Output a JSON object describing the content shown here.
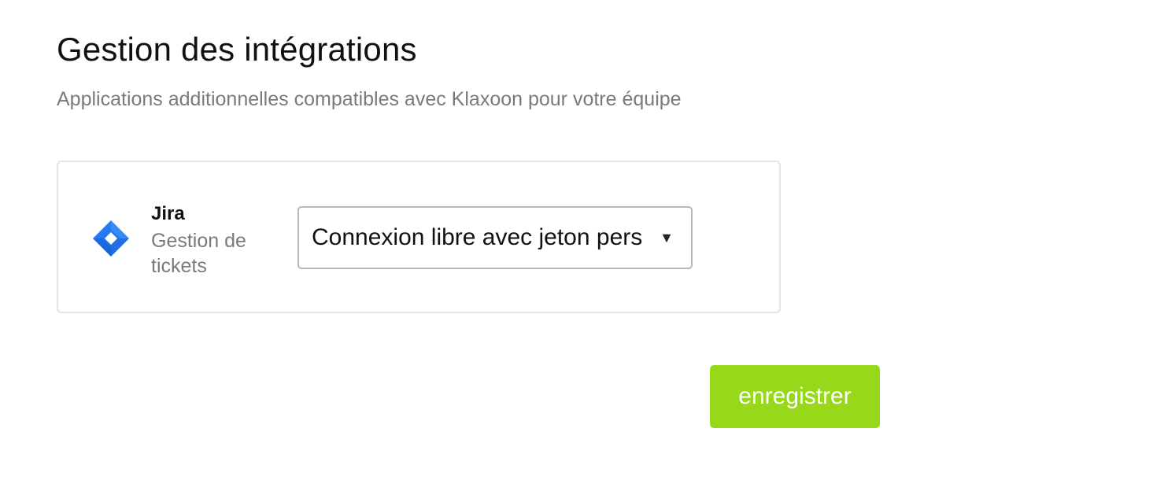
{
  "header": {
    "title": "Gestion des intégrations",
    "subtitle": "Applications additionnelles compatibles avec Klaxoon pour votre équipe"
  },
  "integrations": [
    {
      "name": "Jira",
      "description": "Gestion de tickets",
      "icon": "jira-icon",
      "select": {
        "selected": "Connexion libre avec jeton pers"
      }
    }
  ],
  "actions": {
    "save_label": "enregistrer"
  },
  "colors": {
    "accent": "#97d81a",
    "jira_blue": "#2684ff",
    "jira_blue_dark": "#0052cc",
    "muted_text": "#7a7a7a"
  }
}
